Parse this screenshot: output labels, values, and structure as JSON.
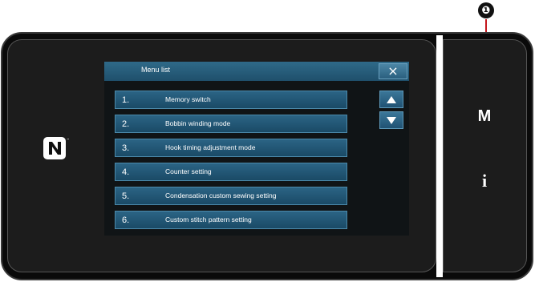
{
  "callout": {
    "badge": "❶"
  },
  "dialog": {
    "title": "Menu list",
    "close_icon": "×",
    "items": [
      {
        "num": "1.",
        "label": "Memory switch"
      },
      {
        "num": "2.",
        "label": "Bobbin winding mode"
      },
      {
        "num": "3.",
        "label": "Hook timing adjustment mode"
      },
      {
        "num": "4.",
        "label": "Counter setting"
      },
      {
        "num": "5.",
        "label": "Condensation custom sewing setting"
      },
      {
        "num": "6.",
        "label": "Custom stitch pattern setting"
      }
    ],
    "scroll_up_icon": "triangle-up-icon",
    "scroll_down_icon": "triangle-down-icon"
  },
  "side_keys": {
    "menu": "M",
    "info": "i"
  },
  "nfc_icon": "nfc-icon",
  "colors": {
    "accent": "#c4161c",
    "button_blue": "#2b6485",
    "header_blue": "#2f6a89"
  }
}
